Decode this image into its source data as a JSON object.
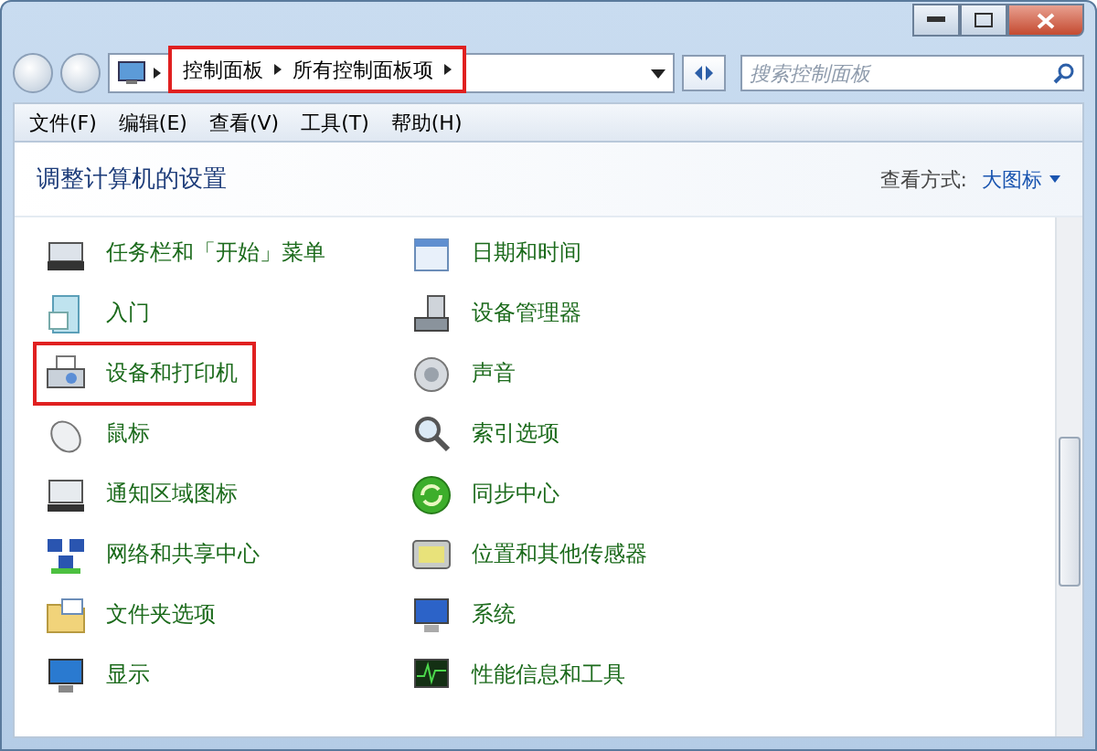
{
  "address": {
    "crumbs": [
      "控制面板",
      "所有控制面板项"
    ],
    "highlighted": true
  },
  "search": {
    "placeholder": "搜索控制面板"
  },
  "menu": [
    "文件(F)",
    "编辑(E)",
    "查看(V)",
    "工具(T)",
    "帮助(H)"
  ],
  "header": {
    "title": "调整计算机的设置",
    "view_label": "查看方式:",
    "view_value": "大图标"
  },
  "items": [
    {
      "label": "任务栏和「开始」菜单",
      "highlighted": false
    },
    {
      "label": "日期和时间",
      "highlighted": false
    },
    {
      "label": "入门",
      "highlighted": false
    },
    {
      "label": "设备管理器",
      "highlighted": false
    },
    {
      "label": "设备和打印机",
      "highlighted": true
    },
    {
      "label": "声音",
      "highlighted": false
    },
    {
      "label": "鼠标",
      "highlighted": false
    },
    {
      "label": "索引选项",
      "highlighted": false
    },
    {
      "label": "通知区域图标",
      "highlighted": false
    },
    {
      "label": "同步中心",
      "highlighted": false
    },
    {
      "label": "网络和共享中心",
      "highlighted": false
    },
    {
      "label": "位置和其他传感器",
      "highlighted": false
    },
    {
      "label": "文件夹选项",
      "highlighted": false
    },
    {
      "label": "系统",
      "highlighted": false
    },
    {
      "label": "显示",
      "highlighted": false
    },
    {
      "label": "性能信息和工具",
      "highlighted": false
    }
  ]
}
